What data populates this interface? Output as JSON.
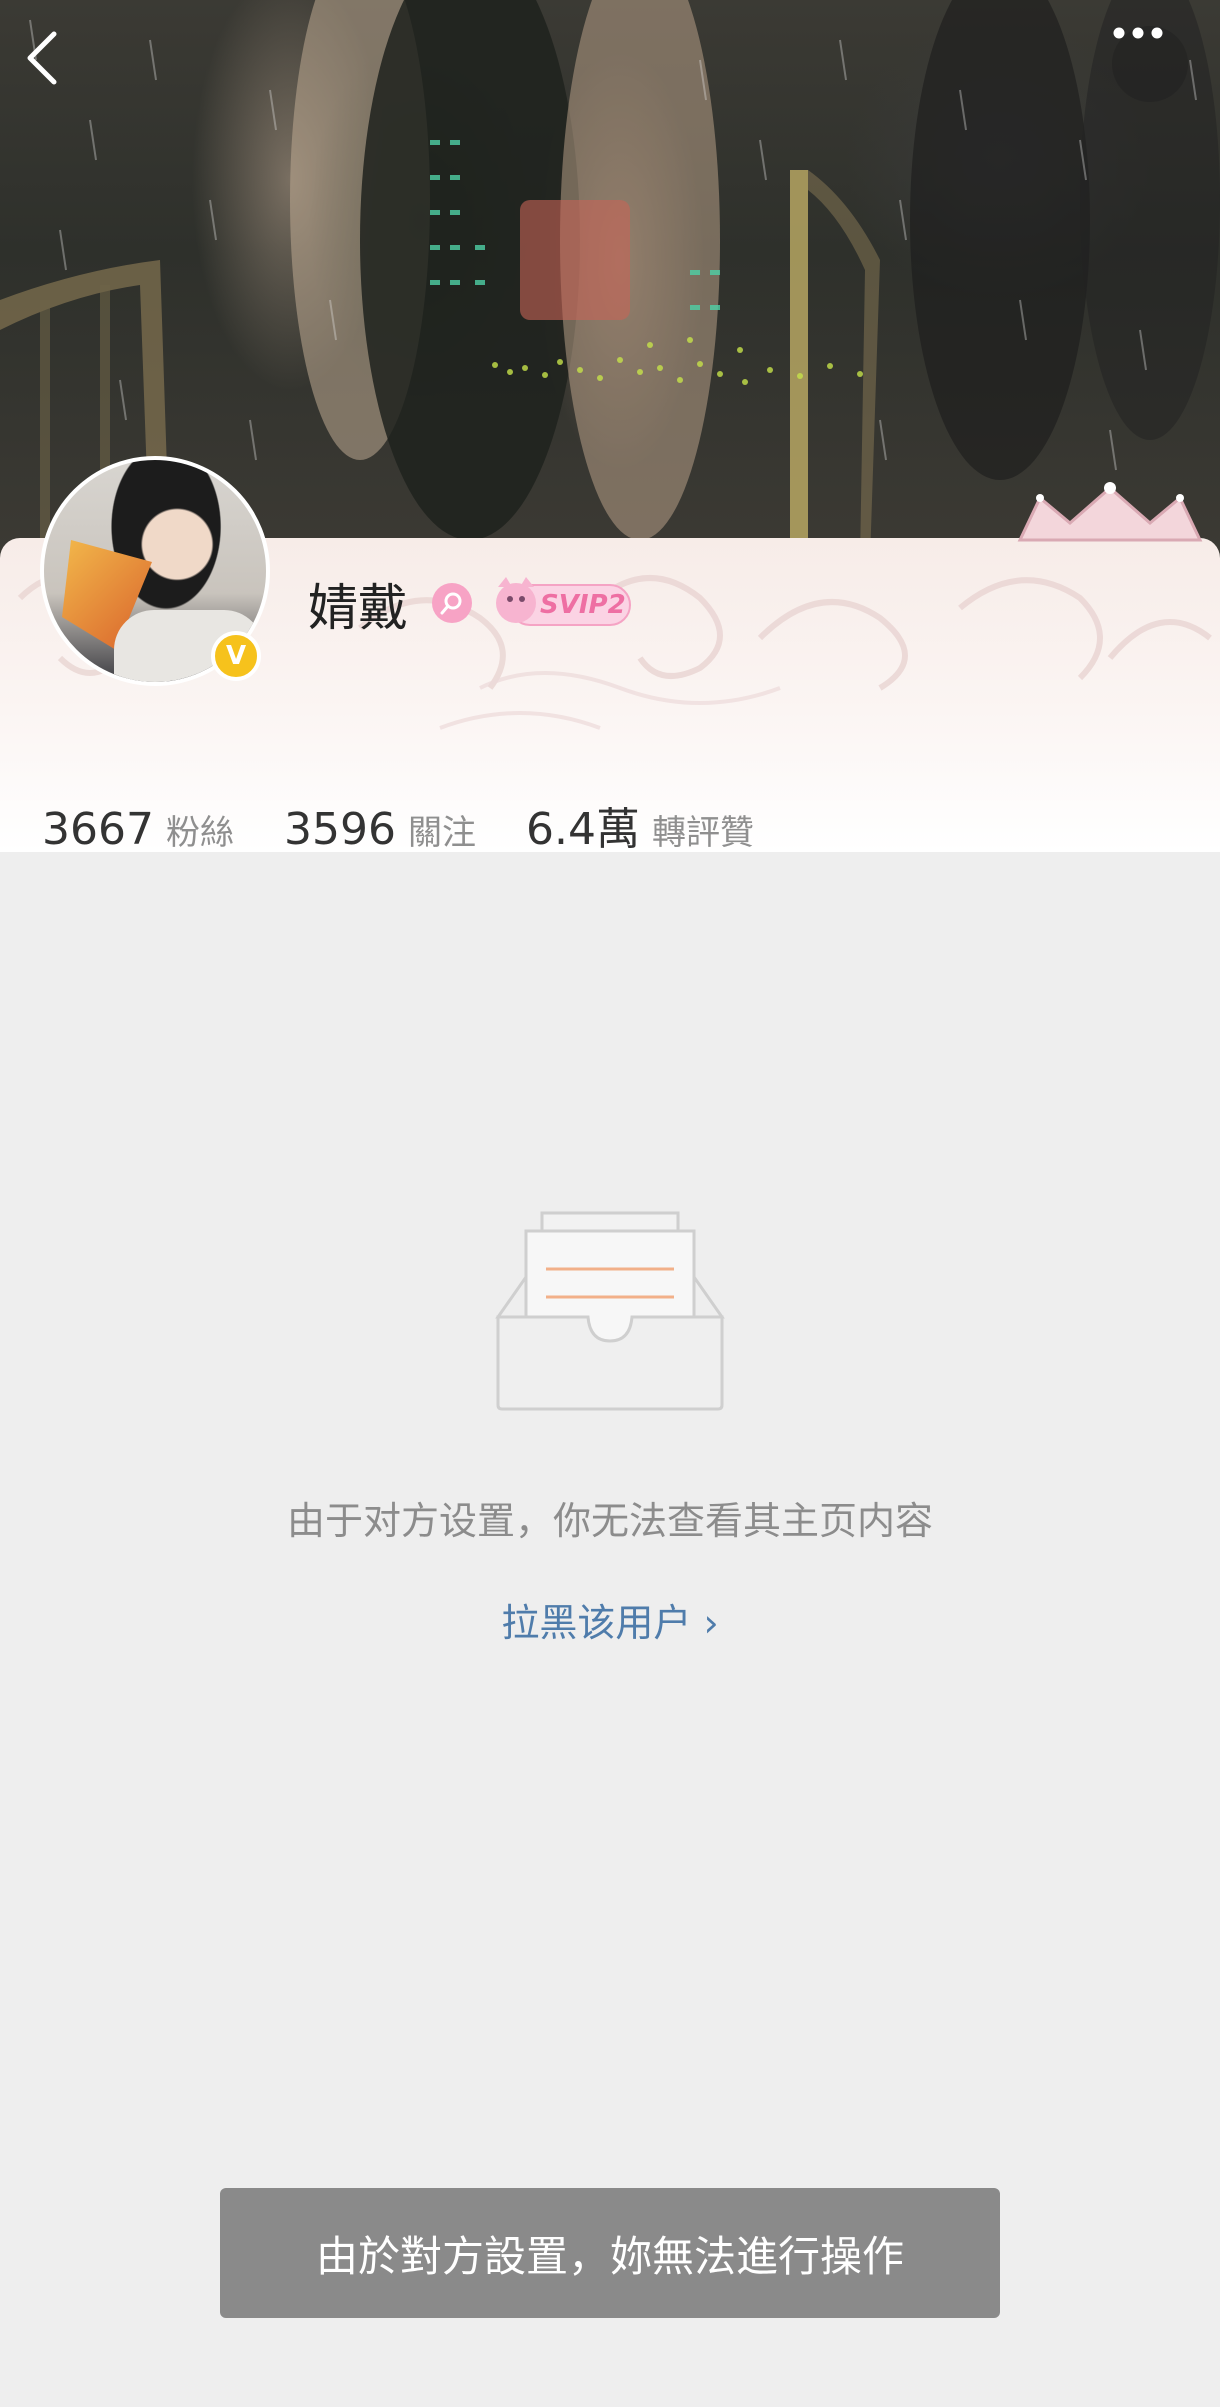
{
  "header": {
    "back_icon": "chevron-left-icon",
    "more_icon": "more-dots-icon"
  },
  "profile": {
    "username": "婧戴",
    "verified_badge": "V",
    "gender_icon": "female-icon",
    "vip_badge": "SVIP2",
    "stats": [
      {
        "value": "3667",
        "label": "粉絲"
      },
      {
        "value": "3596",
        "label": "關注"
      },
      {
        "value": "6.4萬",
        "label": "轉評贊"
      }
    ]
  },
  "empty_state": {
    "icon": "empty-inbox-icon",
    "message": "由于对方设置，你无法查看其主页内容",
    "block_link": "拉黑该用户 ›"
  },
  "toast": {
    "message": "由於對方設置，妳無法進行操作"
  },
  "colors": {
    "accent_link": "#4f7cab",
    "verified": "#f6c21c",
    "background": "#eeeeee"
  }
}
